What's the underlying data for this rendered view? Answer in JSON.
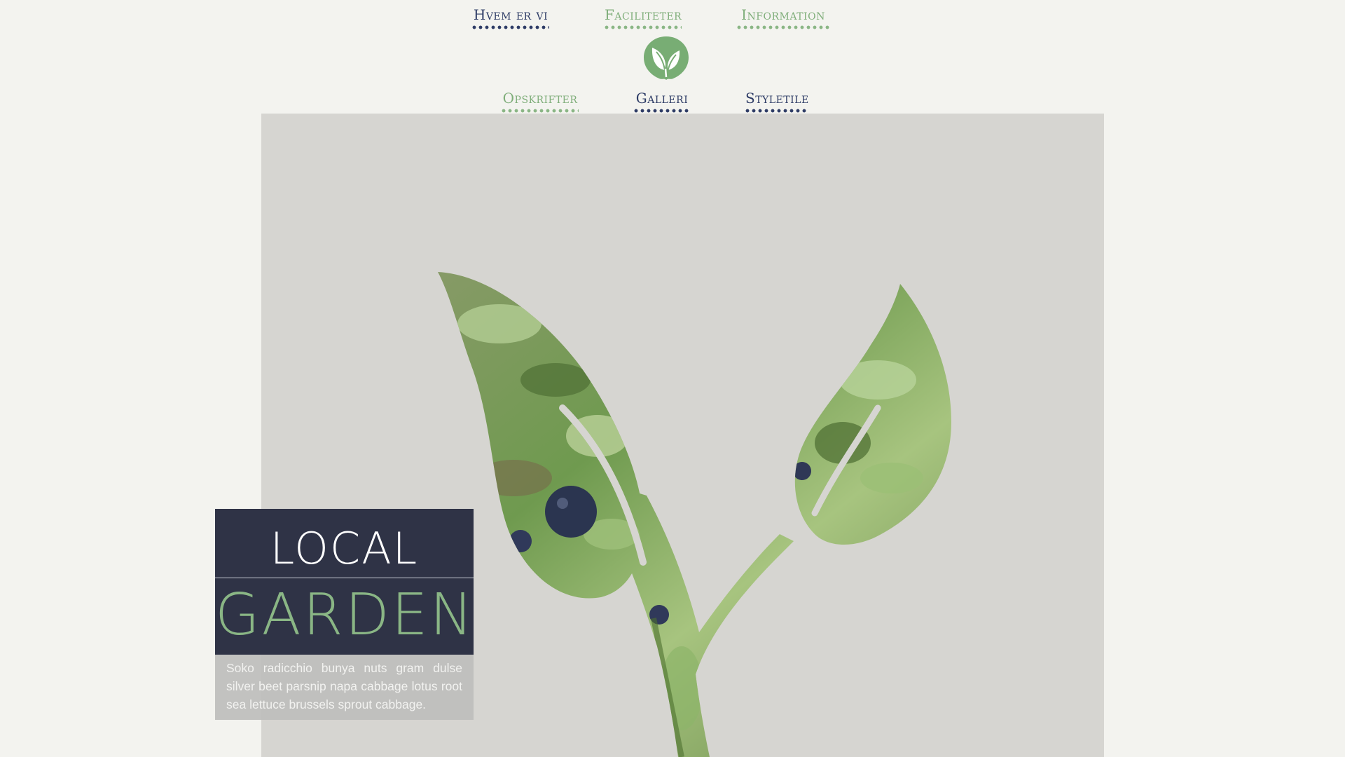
{
  "nav": {
    "top": [
      {
        "label": "Hvem er vi",
        "color": "#2e3c66"
      },
      {
        "label": "Faciliteter",
        "color": "#7fae7a"
      },
      {
        "label": "Information",
        "color": "#7fae7a"
      }
    ],
    "bottom": [
      {
        "label": "Opskrifter",
        "color": "#7fae7a"
      },
      {
        "label": "Galleri",
        "color": "#2e3c66"
      },
      {
        "label": "Styletile",
        "color": "#2e3c66"
      }
    ],
    "logo_icon": "leaf-icon"
  },
  "hero": {
    "title_line1": "LOCAL",
    "title_line2": "GARDEN",
    "description": "Soko radicchio bunya nuts gram dulse silver beet parsnip napa cabbage lotus root sea lettuce brussels sprout cabbage.",
    "image_icon": "sprout-photo-icon"
  },
  "colors": {
    "background": "#f3f3ef",
    "navy": "#2f3346",
    "green": "#8ab685",
    "panel": "#d6d5d1"
  }
}
